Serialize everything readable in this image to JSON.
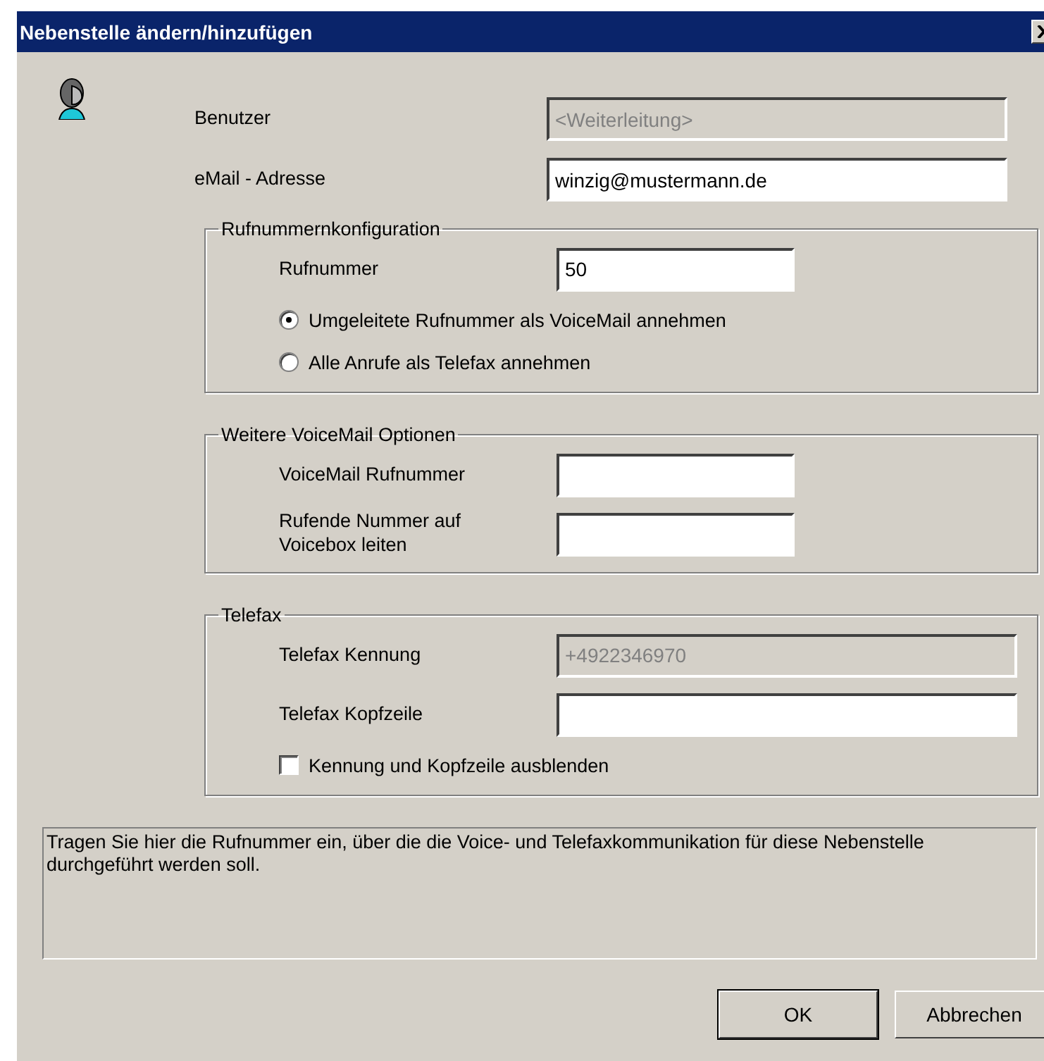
{
  "window": {
    "title": "Nebenstelle ändern/hinzufügen"
  },
  "fields": [
    {
      "label": "Benutzer",
      "value": "<Weiterleitung>",
      "disabled": true
    },
    {
      "label": "eMail - Adresse",
      "value": "winzig@mustermann.de",
      "disabled": false
    }
  ],
  "groups": [
    {
      "title": "Rufnummernkonfiguration",
      "rows": [
        {
          "kind": "short-field",
          "label": "Rufnummer",
          "value": "50",
          "disabled": false
        },
        {
          "kind": "radio",
          "label": "Umgeleitete Rufnummer als VoiceMail annehmen",
          "selected": true
        },
        {
          "kind": "radio",
          "label": "Alle Anrufe als Telefax annehmen",
          "selected": false
        }
      ]
    },
    {
      "title": "Weitere VoiceMail Optionen",
      "rows": [
        {
          "kind": "short-field",
          "label": "VoiceMail Rufnummer",
          "disabled": false
        },
        {
          "kind": "short-field",
          "label": "Rufende Nummer auf\nVoicebox leiten",
          "disabled": false
        }
      ]
    },
    {
      "title": "Telefax",
      "rows": [
        {
          "kind": "field",
          "label": "Telefax Kennung",
          "value": "+4922346970",
          "disabled": true
        },
        {
          "kind": "field",
          "label": "Telefax Kopfzeile",
          "disabled": false
        },
        {
          "kind": "checkbox",
          "label": "Kennung und Kopfzeile ausblenden",
          "checked": false
        }
      ]
    }
  ],
  "info": "Tragen Sie hier die Rufnummer ein, über die die Voice- und Telefaxkommunikation für diese Nebenstelle durchgeführt werden soll.",
  "buttons": [
    {
      "label": "OK",
      "default": true
    },
    {
      "label": "Abbrechen",
      "default": false
    }
  ]
}
